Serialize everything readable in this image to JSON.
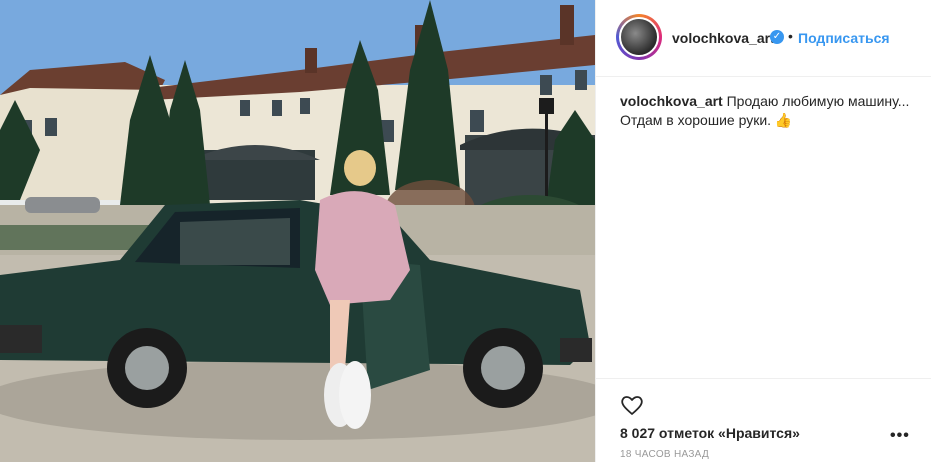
{
  "post": {
    "author": {
      "username": "volochkova_art",
      "verified": true,
      "follow_label": "Подписаться"
    },
    "caption": {
      "username": "volochkova_art",
      "line1": "Продаю любимую машину...",
      "line2": "Отдам в хорошие руки.",
      "emoji": "👍"
    },
    "likes_text": "8 027 отметок «Нравится»",
    "timestamp": "18 ЧАСОВ НАЗАД",
    "icons": {
      "like": "heart-icon",
      "more": "more-options-icon",
      "verified": "verified-badge-icon"
    },
    "colors": {
      "follow": "#3897f0",
      "verified": "#3897f0",
      "car": "#1f3b34"
    }
  }
}
